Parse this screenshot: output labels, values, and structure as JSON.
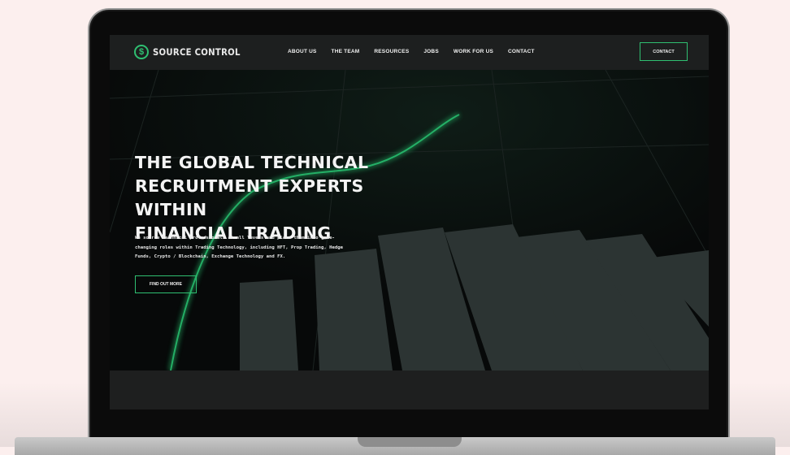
{
  "site": {
    "logo_icon": "$",
    "logo_text": "SOURCE CONTROL"
  },
  "nav": {
    "links": [
      "ABOUT US",
      "THE TEAM",
      "RESOURCES",
      "JOBS",
      "WORK FOR US",
      "CONTACT"
    ],
    "cta_label": "CONTACT"
  },
  "hero": {
    "title_lines": [
      "THE GLOBAL TECHNICAL",
      "RECRUITMENT EXPERTS WITHIN",
      "FINANCIAL TRADING"
    ],
    "description_lines": [
      "We source technical professionals at all levels and place them into game-",
      "changing roles within Trading Technology, including HFT, Prop Trading, Hedge",
      "Funds, Crypto / Blockchain, Exchange Technology and FX."
    ],
    "button_label": "FIND OUT MORE"
  },
  "colors": {
    "accent": "#2fbf71",
    "page_background": "#fcefee",
    "nav_background": "#1d1f1f",
    "hero_background": "#080a0a",
    "bar_color": "#2c3433"
  }
}
